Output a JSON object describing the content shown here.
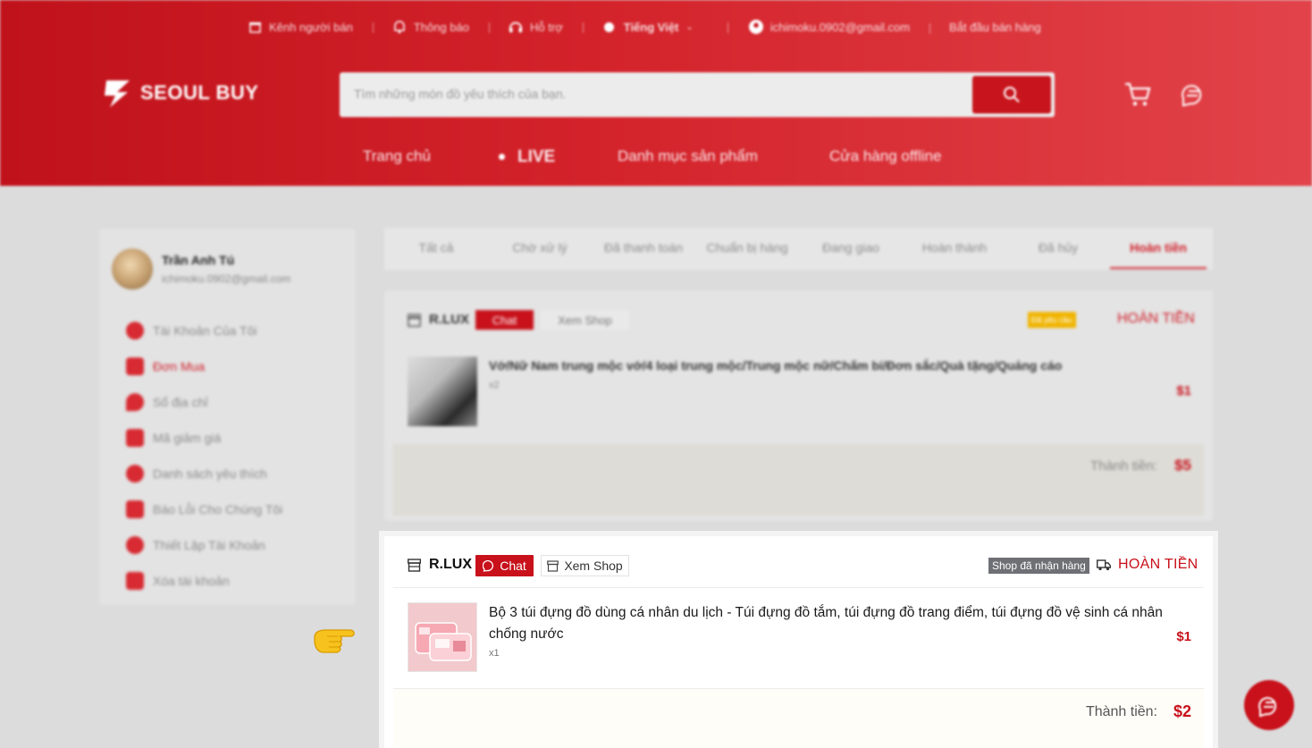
{
  "topbar": {
    "seller_channel": "Kênh người bán",
    "notifications": "Thông báo",
    "support": "Hỗ trợ",
    "language": "Tiếng Việt",
    "account_email": "ichimoku.0902@gmail.com",
    "start_selling": "Bắt đầu bán hàng"
  },
  "brand": {
    "name": "SEOUL BUY"
  },
  "search": {
    "placeholder": "Tìm những món đồ yêu thích của bạn."
  },
  "nav": {
    "home": "Trang chủ",
    "live": "LIVE",
    "categories": "Danh mục sản phẩm",
    "offline_stores": "Cửa hàng offline"
  },
  "sidebar": {
    "user_name": "Trần Anh Tú",
    "user_email": "ichimoku.0902@gmail.com",
    "items": [
      {
        "label": "Tài Khoản Của Tôi"
      },
      {
        "label": "Đơn Mua"
      },
      {
        "label": "Sổ địa chỉ"
      },
      {
        "label": "Mã giảm giá"
      },
      {
        "label": "Danh sách yêu thích"
      },
      {
        "label": "Báo Lỗi Cho Chúng Tôi"
      },
      {
        "label": "Thiết Lập Tài Khoản"
      },
      {
        "label": "Xóa tài khoản"
      }
    ]
  },
  "tabs": [
    {
      "label": "Tất cả"
    },
    {
      "label": "Chờ xử lý"
    },
    {
      "label": "Đã thanh toán"
    },
    {
      "label": "Chuẩn bị hàng"
    },
    {
      "label": "Đang giao"
    },
    {
      "label": "Hoàn thành"
    },
    {
      "label": "Đã hủy"
    },
    {
      "label": "Hoàn tiền"
    }
  ],
  "orders": [
    {
      "shop": "R.LUX",
      "chat_label": "Chat",
      "view_shop_label": "Xem Shop",
      "badge": "Đã yêu cầu",
      "status": "HOÀN TIỀN",
      "product_name": "Vớ/Nữ Nam trung mộc vớ/4 loại trung mộc/Trung mộc nữ/Chấm bi/Đơn sắc/Quà tặng/Quảng cáo",
      "quantity": "x2",
      "price": "$1",
      "total_label": "Thành tiền:",
      "total": "$5"
    },
    {
      "shop": "R.LUX",
      "chat_label": "Chat",
      "view_shop_label": "Xem Shop",
      "badge": "Shop đã nhận hàng",
      "status": "HOÀN TIỀN",
      "product_name": "Bộ 3 túi đựng đồ dùng cá nhân du lịch - Túi đựng đồ tắm, túi đựng đồ trang điểm, túi đựng đồ vệ sinh cá nhân chống nước",
      "quantity": "x1",
      "price": "$1",
      "total_label": "Thành tiền:",
      "total": "$2"
    }
  ],
  "colors": {
    "brand_red": "#c8111b",
    "badge_gray": "#6e7075",
    "badge_amber": "#f0b400"
  }
}
